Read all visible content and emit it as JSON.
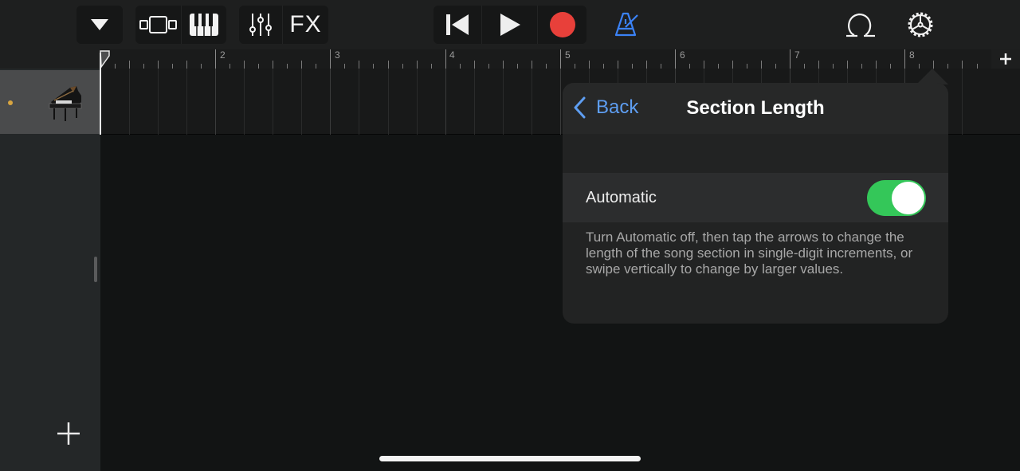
{
  "toolbar": {
    "left_groups": [
      {
        "icons": [
          "dropdown-triangle-icon"
        ]
      },
      {
        "icons": [
          "tracks-view-icon",
          "keyboard-icon"
        ]
      },
      {
        "icons": [
          "mixer-sliders-icon"
        ],
        "fx_label": "FX"
      }
    ],
    "transport": [
      "go-to-beginning-icon",
      "play-icon",
      "record-icon"
    ],
    "metronome_color": "#3b82f6",
    "record_color": "#e8403a",
    "right_icons": [
      "loop-browser-icon",
      "settings-gear-icon"
    ]
  },
  "ruler": {
    "bar_numbers": [
      "2",
      "3",
      "4",
      "5",
      "6",
      "7",
      "8"
    ],
    "add_section_label": "+"
  },
  "track": {
    "instrument": "Grand Piano",
    "indicator_color": "#d8a540"
  },
  "popover": {
    "back_label": "Back",
    "title": "Section Length",
    "automatic_label": "Automatic",
    "automatic_on": true,
    "toggle_color": "#34c759",
    "footnote": "Turn Automatic off, then tap the arrows to change the length of the song section in single-digit increments, or swipe vertically to change by larger values."
  },
  "sidebar": {
    "add_track_label": "+"
  }
}
